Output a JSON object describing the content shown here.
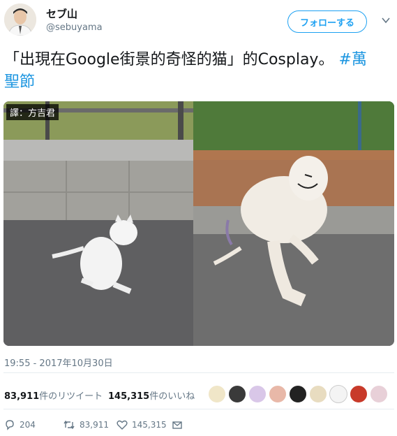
{
  "user": {
    "display_name": "セブ山",
    "handle": "@sebuyama",
    "follow_label": "フォローする"
  },
  "tweet": {
    "text_main": "「出現在Google街景的奇怪的猫」的Cosplay。",
    "hashtag": "#萬聖節"
  },
  "media": {
    "caption": "譯：方吉君"
  },
  "meta": {
    "timestamp": "19:55 - 2017年10月30日"
  },
  "stats": {
    "retweets_count": "83,911",
    "retweets_label": "件のリツイート",
    "likes_count": "145,315",
    "likes_label": "件のいいね"
  },
  "actions": {
    "reply_count": "204",
    "retweet_count": "83,911",
    "like_count": "145,315"
  },
  "colors": {
    "accent": "#1da1f2",
    "hashtag": "#1b95e0",
    "muted": "#657786"
  },
  "icons": [
    "chevron-down-icon",
    "reply-icon",
    "retweet-icon",
    "like-icon",
    "message-icon"
  ]
}
